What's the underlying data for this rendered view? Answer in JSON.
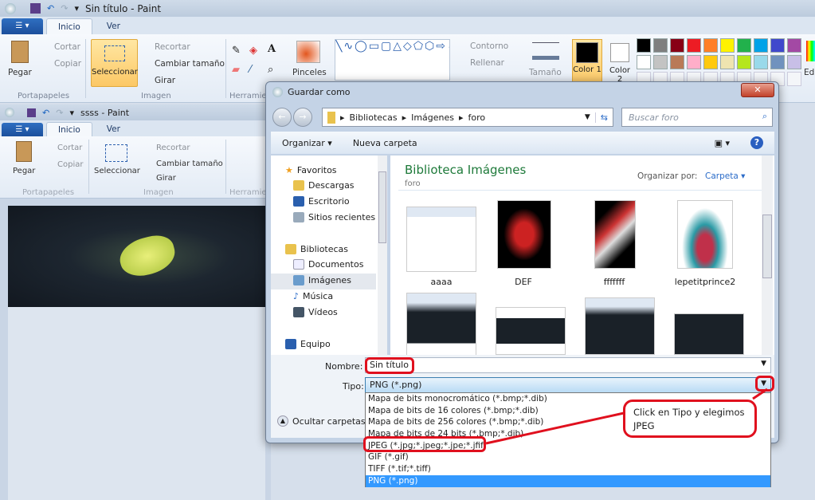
{
  "paint_main": {
    "title": "Sin título - Paint",
    "tabs": [
      "Inicio",
      "Ver"
    ],
    "clipboard": {
      "paste": "Pegar",
      "cut": "Cortar",
      "copy": "Copiar",
      "group": "Portapapeles"
    },
    "image": {
      "select": "Seleccionar",
      "crop": "Recortar",
      "resize": "Cambiar tamaño",
      "rotate": "Girar",
      "group": "Imagen"
    },
    "tools_group": "Herramientas",
    "brushes": "Pinceles",
    "shapes": {
      "outline": "Contorno",
      "fill": "Rellenar"
    },
    "size": "Tamaño",
    "color1": "Color 1",
    "color2": "Color 2",
    "edit_colors": "Editar colores",
    "palette": [
      "#000000",
      "#7f7f7f",
      "#880015",
      "#ed1c24",
      "#ff7f27",
      "#fff200",
      "#22b14c",
      "#00a2e8",
      "#3f48cc",
      "#a349a4",
      "#ffffff",
      "#c3c3c3",
      "#b97a57",
      "#ffaec9",
      "#ffc90e",
      "#efe4b0",
      "#b5e61d",
      "#99d9ea",
      "#7092be",
      "#c8bfe7"
    ]
  },
  "paint_second": {
    "title": "ssss - Paint",
    "tabs": [
      "Inicio",
      "Ver"
    ],
    "clipboard": {
      "paste": "Pegar",
      "cut": "Cortar",
      "copy": "Copiar",
      "group": "Portapapeles"
    },
    "image": {
      "select": "Seleccionar",
      "crop": "Recortar",
      "resize": "Cambiar tamaño",
      "rotate": "Girar",
      "group": "Imagen"
    },
    "tools_group": "Herramientas"
  },
  "dialog": {
    "title": "Guardar como",
    "breadcrumb": [
      "Bibliotecas",
      "Imágenes",
      "foro"
    ],
    "search_placeholder": "Buscar foro",
    "organize": "Organizar",
    "new_folder": "Nueva carpeta",
    "nav": {
      "favorites": "Favoritos",
      "fav_items": [
        "Descargas",
        "Escritorio",
        "Sitios recientes"
      ],
      "libraries": "Bibliotecas",
      "lib_items": [
        "Documentos",
        "Imágenes",
        "Música",
        "Vídeos"
      ],
      "computer": "Equipo"
    },
    "library_title": "Biblioteca Imágenes",
    "library_sub": "foro",
    "arrange_by_label": "Organizar por:",
    "arrange_by_value": "Carpeta",
    "files": [
      "aaaa",
      "DEF",
      "fffffff",
      "lepetitprince2"
    ],
    "name_label": "Nombre:",
    "name_value": "Sin título",
    "type_label": "Tipo:",
    "type_value": "PNG (*.png)",
    "hide_folders": "Ocultar carpetas",
    "type_options": [
      "Mapa de bits monocromático (*.bmp;*.dib)",
      "Mapa de bits de 16 colores (*.bmp;*.dib)",
      "Mapa de bits de 256 colores (*.bmp;*.dib)",
      "Mapa de bits de 24 bits (*.bmp;*.dib)",
      "JPEG (*.jpg;*.jpeg;*.jpe;*.jfif)",
      "GIF (*.gif)",
      "TIFF (*.tif;*.tiff)",
      "PNG (*.png)"
    ],
    "selected_option": "PNG (*.png)"
  },
  "annotation": {
    "line1": "Click en Tipo y elegimos",
    "line2": "JPEG",
    "color": "#e0101e"
  }
}
